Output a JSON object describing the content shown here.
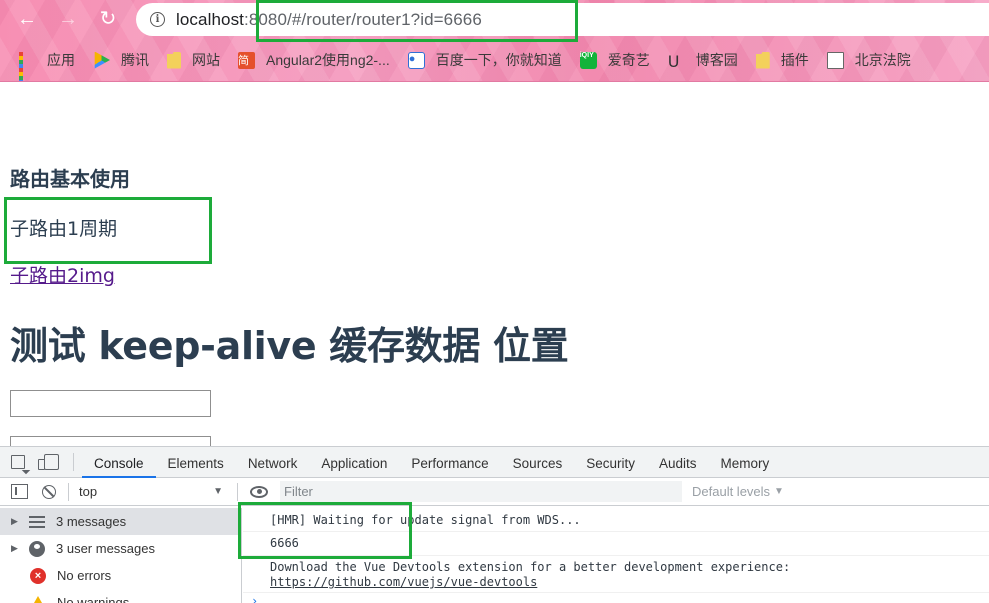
{
  "browser": {
    "url_host": "localhost",
    "url_rest": ":8080/#/router/router1?id=6666",
    "bookmarks": [
      {
        "label": "应用",
        "icon": "apps-icon"
      },
      {
        "label": "腾讯",
        "icon": "tencent-video-icon"
      },
      {
        "label": "网站",
        "icon": "folder-icon"
      },
      {
        "label": "Angular2使用ng2-...",
        "icon": "jianshu-icon"
      },
      {
        "label": "百度一下，你就知道",
        "icon": "baidu-icon"
      },
      {
        "label": "爱奇艺",
        "icon": "iqiyi-icon"
      },
      {
        "label": "博客园",
        "icon": "cnblogs-icon"
      },
      {
        "label": "插件",
        "icon": "folder-icon"
      },
      {
        "label": "北京法院",
        "icon": "page-icon"
      }
    ]
  },
  "page": {
    "heading": "路由基本使用",
    "child1_text": "子路由1周期",
    "child2_link": "子路由2img",
    "title": "测试 keep-alive 缓存数据 位置",
    "input1_value": "",
    "input2_value": ""
  },
  "devtools": {
    "tabs": [
      "Console",
      "Elements",
      "Network",
      "Application",
      "Performance",
      "Sources",
      "Security",
      "Audits",
      "Memory"
    ],
    "active_tab": "Console",
    "context": "top",
    "filter_placeholder": "Filter",
    "levels_label": "Default levels",
    "sidebar": [
      {
        "label": "3 messages",
        "icon": "list-icon",
        "expandable": true,
        "selected": true
      },
      {
        "label": "3 user messages",
        "icon": "user-icon",
        "expandable": true,
        "selected": false
      },
      {
        "label": "No errors",
        "icon": "error-icon",
        "expandable": false,
        "selected": false
      },
      {
        "label": "No warnings",
        "icon": "warning-icon",
        "expandable": false,
        "selected": false
      }
    ],
    "console": {
      "line1": "[HMR] Waiting for update signal from WDS...",
      "line2": "6666",
      "line3": "Download the Vue Devtools extension for a better development experience:",
      "line3_link": "https://github.com/vuejs/vue-devtools"
    }
  },
  "colors": {
    "highlight": "#1dab3a",
    "page_text": "#2c3e50",
    "link_visited": "#551a8b",
    "tab_active": "#1a73e8"
  }
}
